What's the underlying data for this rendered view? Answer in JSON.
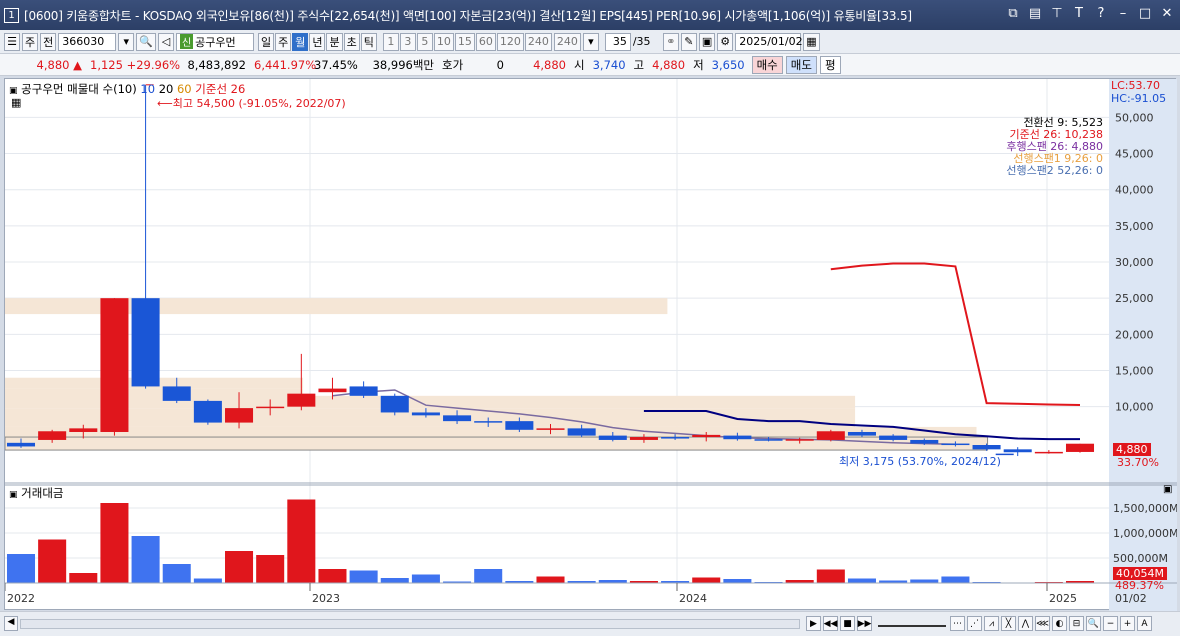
{
  "titlebar": {
    "window_number": "1",
    "title": "[0600] 키움종합차트 - KOSDAQ 외국인보유[86(천)] 주식수[22,654(천)] 액면[100] 자본금[23(억)] 결산[12월] EPS[445] PER[10.96] 시가총액[1,106(억)] 유통비율[33.5]",
    "icons": [
      "restore-icon",
      "tile-icon",
      "pin-icon",
      "font-icon",
      "help-icon",
      "minimize-icon",
      "maximize-icon",
      "close-icon"
    ]
  },
  "toolbar": {
    "period_unit": "주",
    "prev_label": "전",
    "code": "366030",
    "name_badge": "신",
    "stock_name": "공구우먼",
    "periods": [
      "일",
      "주",
      "월",
      "년",
      "분",
      "초",
      "틱"
    ],
    "active_period": "월",
    "intervals": [
      "1",
      "3",
      "5",
      "10",
      "15",
      "60",
      "120",
      "240"
    ],
    "interval_select": "240",
    "count": "35",
    "count_total": "/35",
    "date": "2025/01/02"
  },
  "quote": {
    "price": "4,880",
    "change": "1,125",
    "change_pct": "+29.96%",
    "volume": "8,483,892",
    "volume_ratio": "6,441.97%",
    "turnover": "37.45%",
    "amount": "38,996백만",
    "bid_label": "호가",
    "bid_value": "0",
    "bid_price": "4,880",
    "open_label": "시",
    "open": "3,740",
    "high_label": "고",
    "high": "4,880",
    "low_label": "저",
    "low": "3,650",
    "sell_label": "매수",
    "buy_label": "매도",
    "flat_label": "평"
  },
  "upper": {
    "legend_title": "공구우먼 매물대 수(10)",
    "ma_periods": [
      "10",
      "20",
      "60"
    ],
    "ichimoku_label": "기준선 26",
    "max_label": "최고 54,500 (-91.05%, 2022/07)",
    "min_label": "최저 3,175 (53.70%, 2024/12)",
    "lc_label": "LC:53.70",
    "hc_label": "HC:-91.05",
    "ichimoku_values": [
      {
        "text": "전환선 9: 5,523",
        "color": "#000000"
      },
      {
        "text": "기준선 26: 10,238",
        "color": "#e0161c"
      },
      {
        "text": "후행스팬 26: 4,880",
        "color": "#7a2fa0"
      },
      {
        "text": "선행스팬1 9,26: 0",
        "color": "#e8a040"
      },
      {
        "text": "선행스팬2 52,26: 0",
        "color": "#4a6fb0"
      }
    ],
    "axis_ticks": [
      "50,000",
      "45,000",
      "40,000",
      "35,000",
      "30,000",
      "25,000",
      "20,000",
      "15,000",
      "10,000"
    ],
    "price_box": "4,880",
    "price_pct": "33.70%"
  },
  "lower": {
    "legend_title": "거래대금",
    "axis_ticks": [
      "1,500,000M",
      "1,000,000M",
      "500,000M"
    ],
    "value_box": "40,054M",
    "value_pct": "489.37%"
  },
  "time_axis": {
    "labels": [
      "2022",
      "2023",
      "2024",
      "2025",
      "01/02"
    ]
  },
  "colors": {
    "up": "#e0161c",
    "down": "#1a56d6",
    "volume_profile": "#f5e6d6",
    "kijun": "#e0161c",
    "tenkan": "#000080",
    "chikou": "#7a6aa0"
  },
  "chart_data": {
    "type": "candlestick",
    "ylim": [
      0,
      55000
    ],
    "candles": [
      {
        "o": 5000,
        "h": 5600,
        "l": 4300,
        "c": 4500
      },
      {
        "o": 5400,
        "h": 6800,
        "l": 5000,
        "c": 6600
      },
      {
        "o": 6500,
        "h": 7500,
        "l": 5600,
        "c": 7000
      },
      {
        "o": 6500,
        "h": 25000,
        "l": 6000,
        "c": 25000
      },
      {
        "o": 25000,
        "h": 54500,
        "l": 12500,
        "c": 12800
      },
      {
        "o": 12800,
        "h": 14000,
        "l": 10500,
        "c": 10800
      },
      {
        "o": 10800,
        "h": 11000,
        "l": 7500,
        "c": 7800
      },
      {
        "o": 7800,
        "h": 12000,
        "l": 7000,
        "c": 9800
      },
      {
        "o": 9800,
        "h": 11000,
        "l": 8800,
        "c": 10000
      },
      {
        "o": 10000,
        "h": 17300,
        "l": 9500,
        "c": 11800
      },
      {
        "o": 12000,
        "h": 14000,
        "l": 11000,
        "c": 12500
      },
      {
        "o": 12800,
        "h": 13500,
        "l": 11200,
        "c": 11500
      },
      {
        "o": 11500,
        "h": 11800,
        "l": 8800,
        "c": 9200
      },
      {
        "o": 9200,
        "h": 9800,
        "l": 8500,
        "c": 8800
      },
      {
        "o": 8800,
        "h": 9500,
        "l": 7600,
        "c": 8000
      },
      {
        "o": 8000,
        "h": 8500,
        "l": 7200,
        "c": 7800
      },
      {
        "o": 8000,
        "h": 8500,
        "l": 6500,
        "c": 6800
      },
      {
        "o": 6800,
        "h": 7600,
        "l": 6200,
        "c": 7000
      },
      {
        "o": 7000,
        "h": 7500,
        "l": 5800,
        "c": 6000
      },
      {
        "o": 6000,
        "h": 6500,
        "l": 5200,
        "c": 5400
      },
      {
        "o": 5400,
        "h": 6200,
        "l": 5000,
        "c": 5800
      },
      {
        "o": 5800,
        "h": 6200,
        "l": 5400,
        "c": 5700
      },
      {
        "o": 5800,
        "h": 6500,
        "l": 5200,
        "c": 6100
      },
      {
        "o": 6000,
        "h": 6400,
        "l": 5300,
        "c": 5500
      },
      {
        "o": 5500,
        "h": 5800,
        "l": 5200,
        "c": 5400
      },
      {
        "o": 5300,
        "h": 5700,
        "l": 4900,
        "c": 5500
      },
      {
        "o": 5400,
        "h": 6800,
        "l": 5200,
        "c": 6600
      },
      {
        "o": 6500,
        "h": 6800,
        "l": 5800,
        "c": 6000
      },
      {
        "o": 6000,
        "h": 6200,
        "l": 5200,
        "c": 5400
      },
      {
        "o": 5400,
        "h": 5600,
        "l": 4700,
        "c": 4900
      },
      {
        "o": 4900,
        "h": 5200,
        "l": 4500,
        "c": 4700
      },
      {
        "o": 4700,
        "h": 4900,
        "l": 3900,
        "c": 4100
      },
      {
        "o": 4100,
        "h": 4400,
        "l": 3175,
        "c": 3700
      },
      {
        "o": 3700,
        "h": 4000,
        "l": 3500,
        "c": 3750
      },
      {
        "o": 3740,
        "h": 4880,
        "l": 3650,
        "c": 4880
      }
    ],
    "volume": [
      580,
      870,
      200,
      1600,
      940,
      380,
      90,
      640,
      560,
      1670,
      280,
      250,
      100,
      170,
      30,
      280,
      40,
      130,
      40,
      60,
      40,
      40,
      110,
      80,
      20,
      60,
      270,
      90,
      50,
      70,
      130,
      20,
      10,
      20,
      40
    ],
    "kijun": [
      null,
      null,
      null,
      null,
      null,
      null,
      null,
      null,
      null,
      null,
      null,
      null,
      null,
      null,
      null,
      null,
      null,
      null,
      null,
      null,
      null,
      null,
      null,
      null,
      null,
      null,
      29000,
      29500,
      29800,
      29800,
      29400,
      10500,
      10400,
      10300,
      10238
    ],
    "tenkan": [
      null,
      null,
      null,
      null,
      null,
      null,
      null,
      null,
      null,
      null,
      null,
      null,
      null,
      null,
      null,
      null,
      null,
      null,
      null,
      null,
      9400,
      9400,
      9400,
      8300,
      8000,
      8000,
      7600,
      7400,
      7200,
      6700,
      6200,
      5900,
      5600,
      5523,
      5523
    ],
    "chikou": [
      null,
      null,
      null,
      null,
      null,
      null,
      null,
      null,
      null,
      null,
      11500,
      12000,
      12300,
      10200,
      9800,
      9400,
      9000,
      8500,
      7900,
      7100,
      6600,
      6300,
      6000,
      5700,
      5600,
      5500,
      5400,
      5200,
      5000,
      4900,
      4800,
      null,
      null,
      null,
      null
    ],
    "volume_profile": [
      {
        "low": 22800,
        "high": 25000,
        "width": 0.6
      },
      {
        "low": 12500,
        "high": 14000,
        "width": 0.27
      },
      {
        "low": 11000,
        "high": 12500,
        "width": 0.27
      },
      {
        "low": 9700,
        "high": 11500,
        "width": 0.77
      },
      {
        "low": 7200,
        "high": 9700,
        "width": 0.77
      },
      {
        "low": 5800,
        "high": 7200,
        "width": 0.88
      },
      {
        "low": 4000,
        "high": 5800,
        "width": 0.89
      }
    ]
  }
}
